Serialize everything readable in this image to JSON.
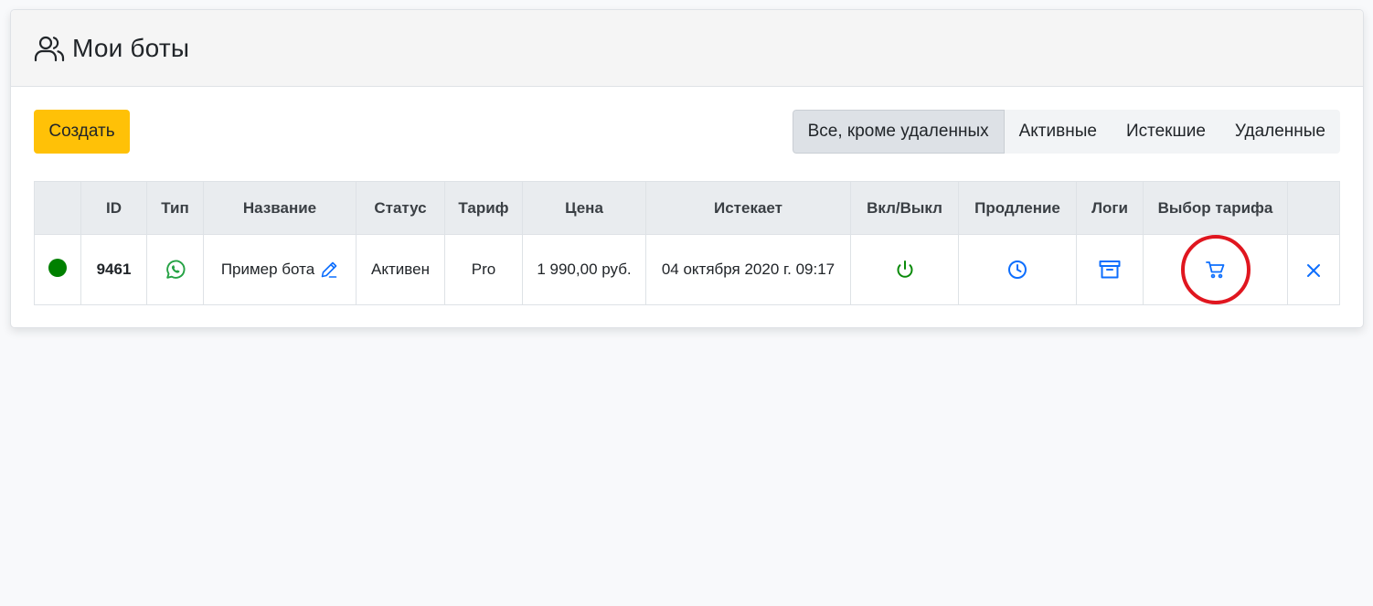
{
  "header": {
    "title": "Мои боты",
    "icon": "users-icon"
  },
  "toolbar": {
    "create_label": "Создать",
    "filters": [
      {
        "label": "Все, кроме удаленных",
        "active": true
      },
      {
        "label": "Активные",
        "active": false
      },
      {
        "label": "Истекшие",
        "active": false
      },
      {
        "label": "Удаленные",
        "active": false
      }
    ]
  },
  "table": {
    "columns": [
      "",
      "ID",
      "Тип",
      "Название",
      "Статус",
      "Тариф",
      "Цена",
      "Истекает",
      "Вкл/Выкл",
      "Продление",
      "Логи",
      "Выбор тарифа",
      ""
    ],
    "rows": [
      {
        "status_dot_color": "#008000",
        "id": "9461",
        "type_icon": "whatsapp-icon",
        "name": "Пример бота",
        "status": "Активен",
        "tariff": "Pro",
        "price": "1 990,00 руб.",
        "expires": "04 октября 2020 г. 09:17"
      }
    ]
  },
  "colors": {
    "accent_yellow": "#ffc107",
    "link_blue": "#0d6efd",
    "success_green": "#0a8a0a",
    "whatsapp_green": "#25a244",
    "highlight_red": "#e0161f"
  }
}
